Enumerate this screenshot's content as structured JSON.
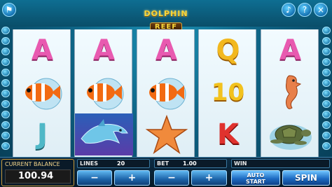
{
  "game": {
    "title_line1": "DOLPHIN",
    "title_line2": "REEF"
  },
  "top_buttons": {
    "left_icon": "flag-icon",
    "right_icons": [
      "speaker-icon",
      "question-icon",
      "close-icon"
    ]
  },
  "reels": [
    [
      "A",
      "clownfish",
      "J"
    ],
    [
      "A",
      "clownfish",
      "dolphin"
    ],
    [
      "A",
      "clownfish",
      "starfish"
    ],
    [
      "Q",
      "10",
      "K"
    ],
    [
      "A",
      "seahorse",
      "turtle"
    ]
  ],
  "panel": {
    "balance_label": "CURRENT BALANCE",
    "balance_value": "100.94",
    "lines_label": "LINES",
    "lines_value": "20",
    "bet_label": "BET",
    "bet_value": "1.00",
    "win_label": "WIN",
    "win_value": "",
    "minus_label": "−",
    "plus_label": "+",
    "auto_line1": "AUTO",
    "auto_line2": "START",
    "spin_label": "SPIN"
  },
  "colors": {
    "letter_a": "#e85ab0",
    "letter_q": "#f2b81e",
    "letter_k": "#e0322e",
    "letter_j": "#4fb8c7",
    "button_blue": "#1c63a8"
  }
}
